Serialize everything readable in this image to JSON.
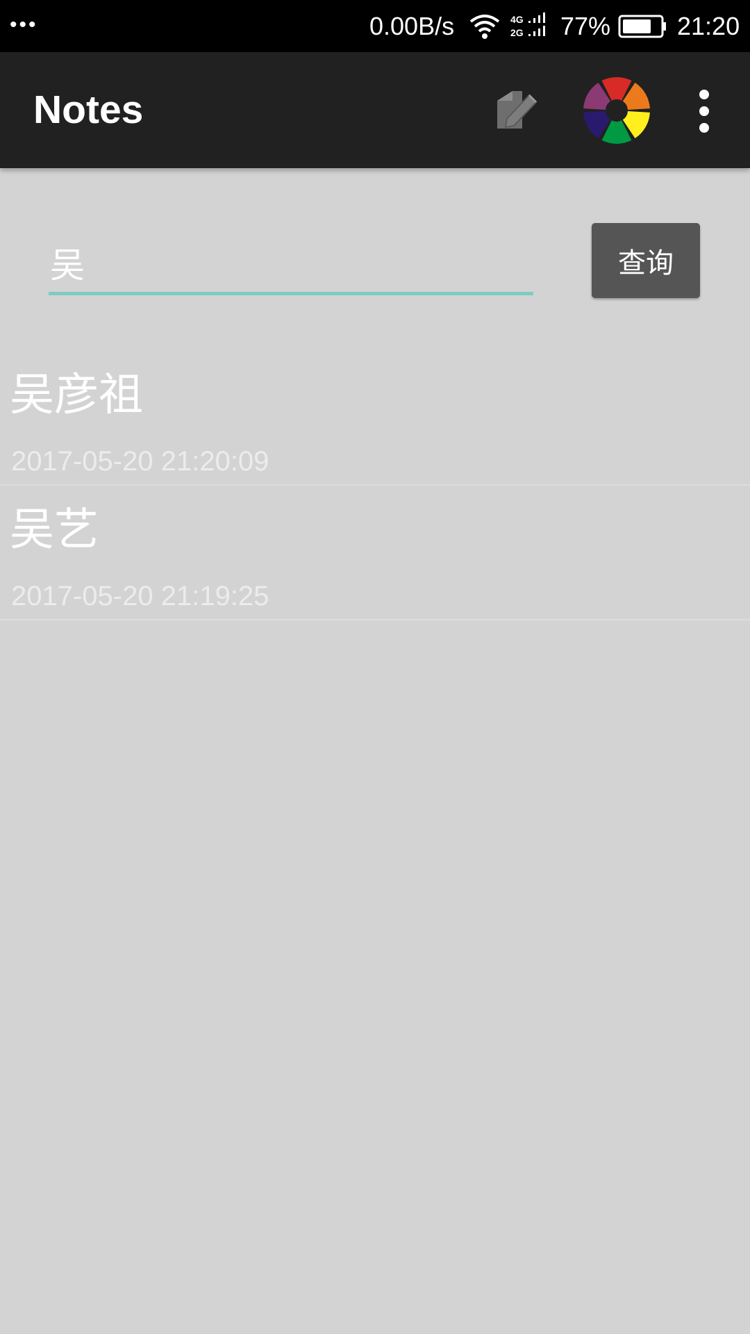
{
  "status_bar": {
    "dots": "•••",
    "net_speed": "0.00B/s",
    "network_top": "4G",
    "network_bottom": "2G",
    "battery_percent": "77%",
    "battery_level": 0.77,
    "time": "21:20"
  },
  "app_bar": {
    "title": "Notes",
    "icons": [
      "edit-note-icon",
      "color-palette-icon",
      "more-vert-icon"
    ]
  },
  "search": {
    "value": "吴",
    "button_label": "查询"
  },
  "notes": [
    {
      "title": "吴彦祖",
      "date": "2017-05-20 21:20:09"
    },
    {
      "title": "吴艺",
      "date": "2017-05-20 21:19:25"
    }
  ],
  "colors": {
    "status_bar": "#000000",
    "app_bar": "#212121",
    "background": "#d3d3d3",
    "accent_underline": "#7fcbc4",
    "button": "#555556",
    "palette": [
      "#d62b27",
      "#ec7a1c",
      "#fff01d",
      "#009944",
      "#2a1a6e",
      "#8b3a74"
    ]
  }
}
